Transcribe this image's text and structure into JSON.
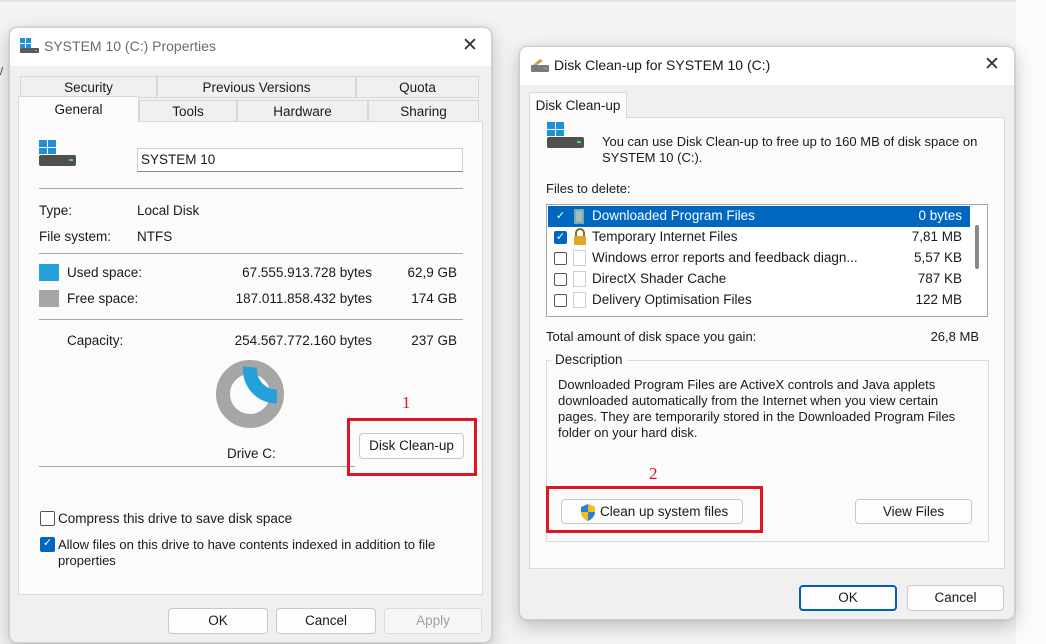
{
  "props_dialog": {
    "title": "SYSTEM 10 (C:) Properties",
    "tabs_row1": [
      "Security",
      "Previous Versions",
      "Quota"
    ],
    "tabs_row2": [
      "General",
      "Tools",
      "Hardware",
      "Sharing"
    ],
    "selected_tab": "General",
    "drive_name_value": "SYSTEM 10",
    "type_label": "Type:",
    "type_value": "Local Disk",
    "fs_label": "File system:",
    "fs_value": "NTFS",
    "used_label": "Used space:",
    "used_bytes": "67.555.913.728 bytes",
    "used_gb": "62,9 GB",
    "free_label": "Free space:",
    "free_bytes": "187.011.858.432 bytes",
    "free_gb": "174 GB",
    "capacity_label": "Capacity:",
    "capacity_bytes": "254.567.772.160 bytes",
    "capacity_gb": "237 GB",
    "drive_label": "Drive C:",
    "cleanup_button": "Disk Clean-up",
    "compress_label": "Compress this drive to save disk space",
    "compress_checked": false,
    "index_label": "Allow files on this drive to have contents indexed in addition to file",
    "index_label_2": "properties",
    "index_checked": true,
    "ok": "OK",
    "cancel": "Cancel",
    "apply": "Apply",
    "used_fraction": 0.265,
    "used_color": "#26a0da",
    "free_color": "#a6a6a6"
  },
  "cleanup_dialog": {
    "title": "Disk Clean-up for SYSTEM 10 (C:)",
    "tab": "Disk Clean-up",
    "intro_line1": "You can use Disk Clean-up to free up to 160 MB of disk space on",
    "intro_line2": "SYSTEM 10 (C:).",
    "files_label": "Files to delete:",
    "files": [
      {
        "name": "Downloaded Program Files",
        "size": "0 bytes",
        "checked": true,
        "icon": "folder-icon"
      },
      {
        "name": "Temporary Internet Files",
        "size": "7,81 MB",
        "checked": true,
        "icon": "lock-icon"
      },
      {
        "name": "Windows error reports and feedback diagn...",
        "size": "5,57 KB",
        "checked": false,
        "icon": "file-icon"
      },
      {
        "name": "DirectX Shader Cache",
        "size": "787 KB",
        "checked": false,
        "icon": "file-icon"
      },
      {
        "name": "Delivery Optimisation Files",
        "size": "122 MB",
        "checked": false,
        "icon": "file-icon"
      }
    ],
    "total_label": "Total amount of disk space you gain:",
    "total_value": "26,8 MB",
    "description_label": "Description",
    "description_lines": [
      "Downloaded Program Files are ActiveX controls and Java applets",
      "downloaded automatically from the Internet when you view certain",
      "pages. They are temporarily stored in the Downloaded Program Files",
      "folder on your hard disk."
    ],
    "cleanup_system_button": "Clean up system files",
    "view_files_button": "View Files",
    "ok": "OK",
    "cancel": "Cancel"
  },
  "annotations": {
    "step1": "1",
    "step2": "2",
    "color": "#e0141e"
  }
}
